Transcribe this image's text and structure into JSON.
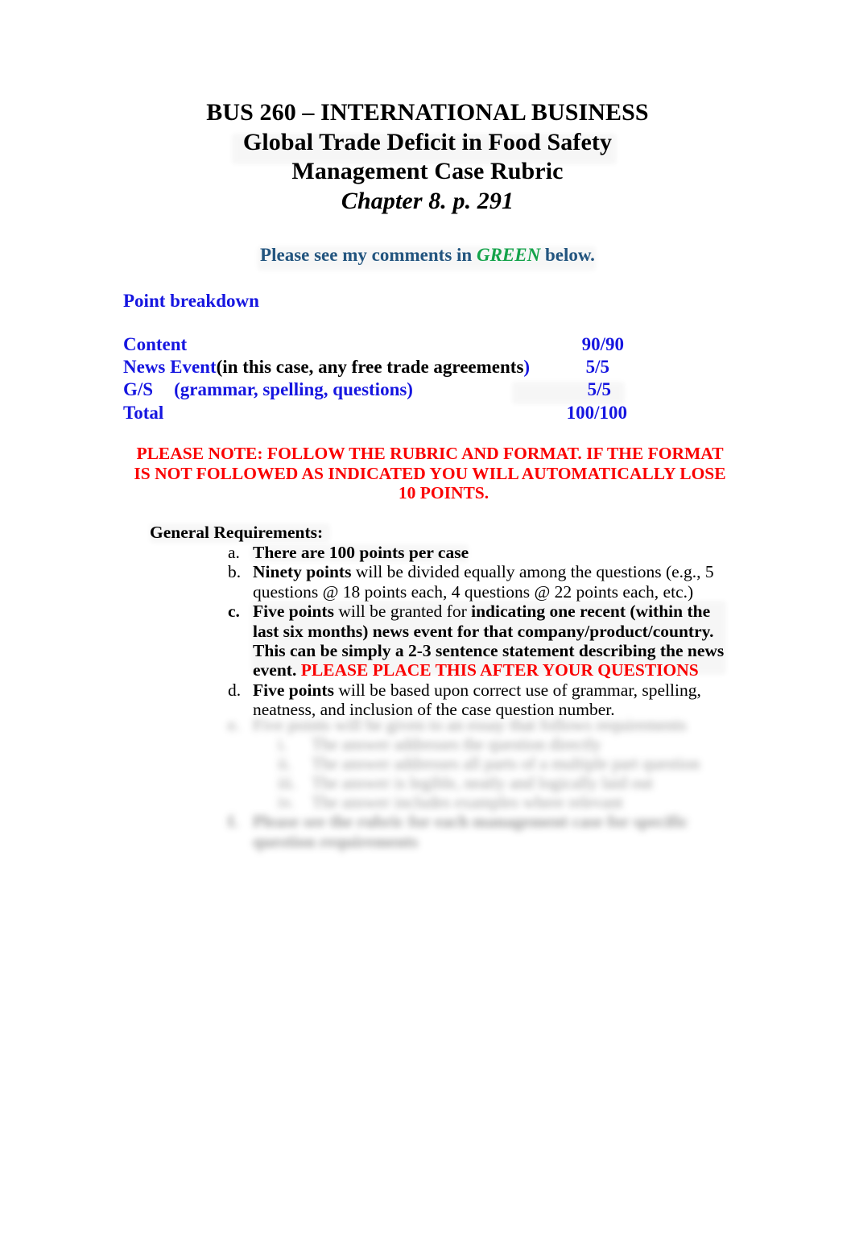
{
  "document": {
    "title_lines": [
      "BUS 260 – INTERNATIONAL BUSINESS",
      "Global Trade Deficit in Food Safety",
      "Management Case Rubric",
      "Chapter 8. p. 291"
    ],
    "comment_note": {
      "before": "Please see my comments in ",
      "highlight": "GREEN",
      "after": " below."
    },
    "point_breakdown": {
      "heading": "Point breakdown",
      "rows": [
        {
          "label": "Content",
          "label_black": "",
          "label_tail": "",
          "score": "90/90"
        },
        {
          "label": "News Event ",
          "label_black": "(in this case, any free trade agreements",
          "label_tail": ")",
          "score": "5/5"
        },
        {
          "label": "G/S",
          "label_black": "",
          "label_tail": "(grammar, spelling, questions)",
          "score": "5/5"
        },
        {
          "label": "Total",
          "label_black": "",
          "label_tail": "",
          "score": "100/100"
        }
      ]
    },
    "warning": {
      "line1": "PLEASE NOTE: FOLLOW THE RUBRIC AND FORMAT. IF THE FORMAT IS",
      "line2a": "NOT FOLLOWED AS INDICATED YOU WILL AUTOMATICALLY LOSE",
      "line2b": "10",
      "line3": "POINTS."
    },
    "general_requirements": {
      "title": "General Requirements:",
      "items": [
        {
          "marker": "a.",
          "marker_bold": false,
          "bold_lead": "There are 100 points per case",
          "regular_text": "",
          "bold_tail": "",
          "red_text": ""
        },
        {
          "marker": "b.",
          "marker_bold": false,
          "bold_lead": "Ninety points",
          "regular_text": " will be divided equally among the questions (e.g., 5 questions @ 18 points each, 4 questions @ 22 points each, etc.)",
          "bold_tail": "",
          "red_text": ""
        },
        {
          "marker": "c.",
          "marker_bold": true,
          "bold_lead": "Five points",
          "regular_text": " will be granted for ",
          "bold_tail": "indicating one recent (within the last six months) news event for that company/product/country. This can be simply a 2-3 sentence statement describing the news event. ",
          "red_text": "PLEASE PLACE THIS AFTER YOUR QUESTIONS"
        },
        {
          "marker": "d.",
          "marker_bold": false,
          "bold_lead": "Five points",
          "regular_text": " will be based upon correct use of grammar, spelling, neatness, and inclusion of the case question number.",
          "bold_tail": "",
          "red_text": ""
        }
      ]
    },
    "redacted_section": {
      "note": "illegible-blurred-content",
      "items": [
        {
          "marker": "e.",
          "bold": false,
          "text": "Five points will be given to an essay that follows requirements"
        }
      ],
      "subitems": [
        {
          "marker": "i.",
          "text": "The answer addresses the question directly"
        },
        {
          "marker": "ii.",
          "text": "The answer addresses all parts of a multiple part question"
        },
        {
          "marker": "iii.",
          "text": "The answer is legible, neatly and logically laid out"
        },
        {
          "marker": "iv.",
          "text": "The answer includes examples where relevant"
        }
      ],
      "closing": {
        "marker": "f.",
        "bold": true,
        "text": "Please see the rubric for each management case for specific question requirements"
      }
    }
  }
}
